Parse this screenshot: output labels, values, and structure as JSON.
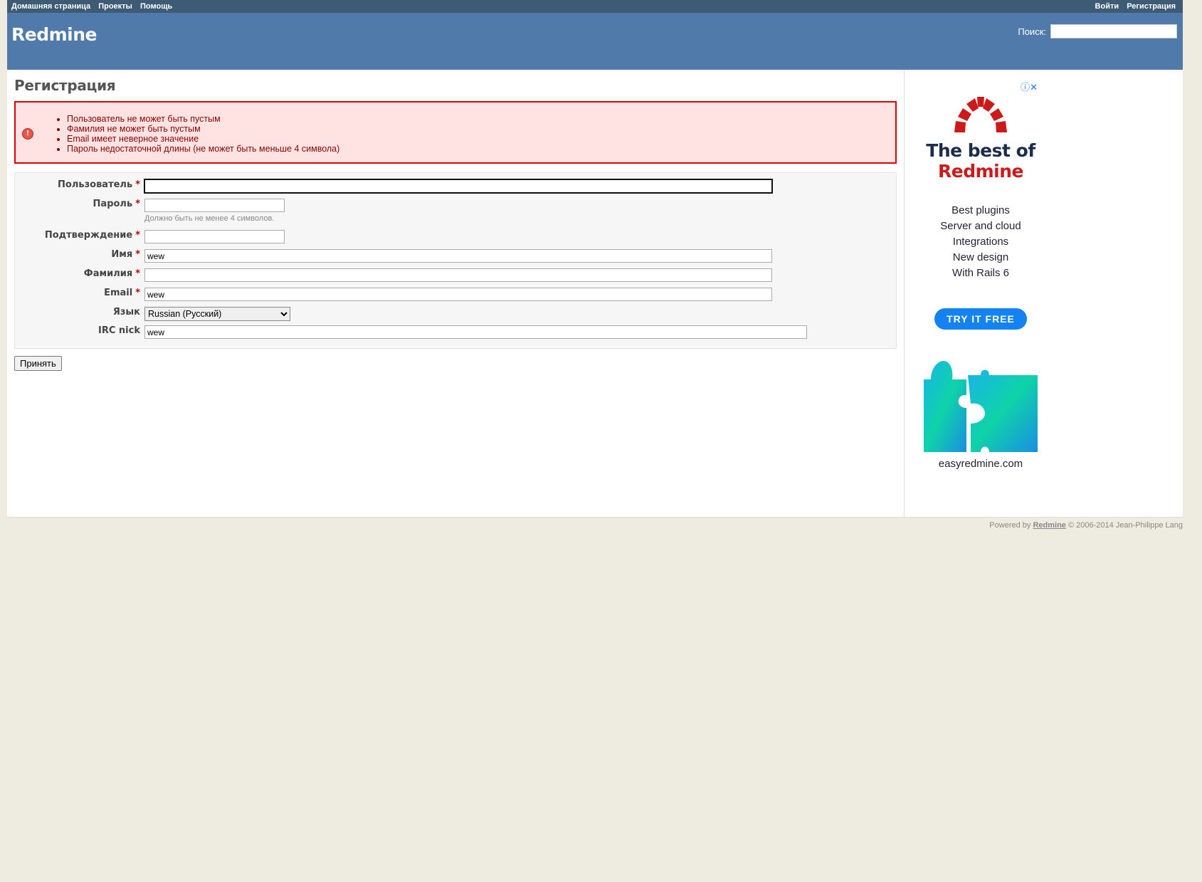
{
  "top_menu": {
    "left": [
      "Домашняя страница",
      "Проекты",
      "Помощь"
    ],
    "right": [
      "Войти",
      "Регистрация"
    ]
  },
  "header": {
    "title": "Redmine",
    "search_label": "Поиск:",
    "search_value": ""
  },
  "page": {
    "title": "Регистрация"
  },
  "errors": [
    "Пользователь не может быть пустым",
    "Фамилия не может быть пустым",
    "Email имеет неверное значение",
    "Пароль недостаточной длины (не может быть меньше 4 символа)"
  ],
  "form": {
    "required_mark": "*",
    "login": {
      "label": "Пользователь",
      "value": ""
    },
    "password": {
      "label": "Пароль",
      "value": "",
      "hint": "Должно быть не менее 4 символов."
    },
    "confirm": {
      "label": "Подтверждение",
      "value": ""
    },
    "firstname": {
      "label": "Имя",
      "value": "wew"
    },
    "lastname": {
      "label": "Фамилия",
      "value": ""
    },
    "email": {
      "label": "Email",
      "value": "wew"
    },
    "language": {
      "label": "Язык",
      "value": "Russian (Русский)"
    },
    "irc": {
      "label": "IRC nick",
      "value": "wew"
    },
    "submit_label": "Принять"
  },
  "ad": {
    "info_icon": "info-icon",
    "close_icon": "close-icon",
    "title_line1": "The best of",
    "title_line2": "Redmine",
    "features": [
      "Best plugins",
      "Server and cloud",
      "Integrations",
      "New design",
      "With Rails 6"
    ],
    "cta": "TRY IT FREE",
    "site": "easyredmine.com",
    "brand_red": "#cc1a1a",
    "cta_color": "#1482f0"
  },
  "footer": {
    "prefix": "Powered by",
    "link": "Redmine",
    "suffix": "© 2006-2014 Jean-Philippe Lang"
  },
  "colors": {
    "top_menu_bg": "#3e5b76",
    "header_bg": "#507aaa",
    "page_bg": "#eeebe0",
    "error_border": "#dd0000",
    "error_bg": "#ffe3e3"
  }
}
